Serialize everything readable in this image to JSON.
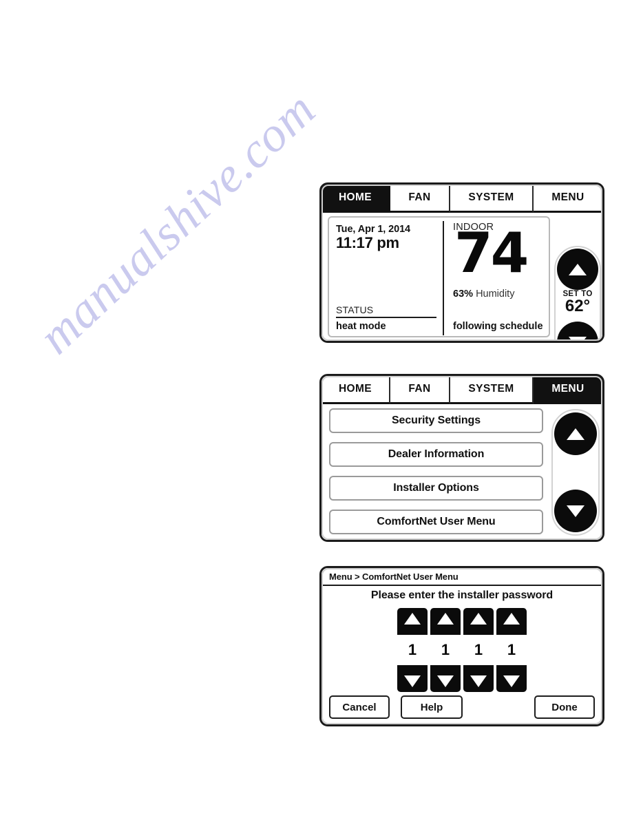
{
  "watermark": {
    "text": "manualshive.com",
    "color": "#cacaee"
  },
  "tabs": [
    "HOME",
    "FAN",
    "SYSTEM",
    "MENU"
  ],
  "icons": {
    "arrow_up": "triangle-up-icon",
    "arrow_down": "triangle-down-icon"
  },
  "panel_home": {
    "active_tab": "HOME",
    "date": "Tue, Apr 1, 2014",
    "time": "11:17 pm",
    "status_label": "STATUS",
    "status_value": "heat mode",
    "indoor_label": "INDOOR",
    "indoor_temp": "74",
    "degree": "°",
    "humidity_value": "63%",
    "humidity_label": "Humidity",
    "schedule": "following schedule",
    "setto_label": "SET TO",
    "setto_value": "62°"
  },
  "panel_menu": {
    "active_tab": "MENU",
    "items": [
      "Security Settings",
      "Dealer Information",
      "Installer Options",
      "ComfortNet User Menu"
    ]
  },
  "panel_password": {
    "breadcrumb": "Menu > ComfortNet User Menu",
    "prompt": "Please enter the installer password",
    "digits": [
      "1",
      "1",
      "1",
      "1"
    ],
    "buttons": {
      "cancel": "Cancel",
      "help": "Help",
      "done": "Done"
    }
  }
}
